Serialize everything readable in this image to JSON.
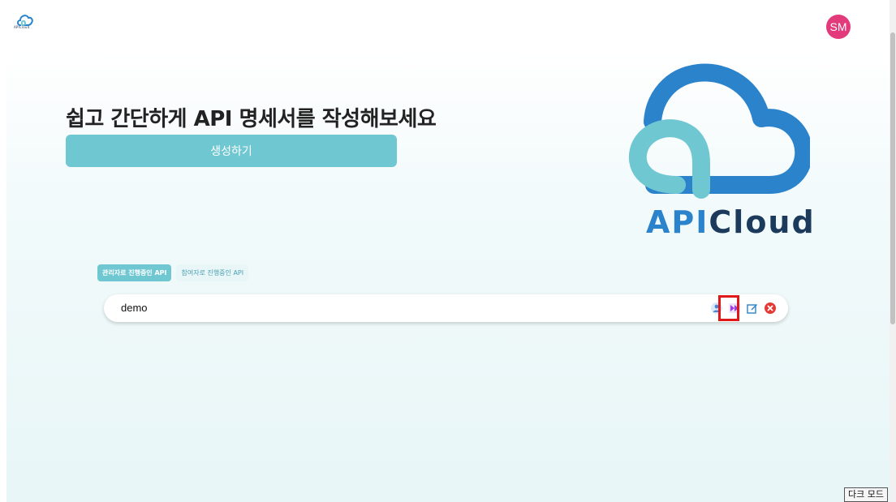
{
  "header": {
    "logo_text": "APICloud",
    "avatar_initials": "SM",
    "avatar_color": "#e23a7a"
  },
  "hero": {
    "headline": "쉽고 간단하게 API 명세서를 작성해보세요",
    "create_button_label": "생성하기",
    "logo_api": "API",
    "logo_cloud": "Cloud"
  },
  "tabs": [
    {
      "label": "관리자로 진행중인 API",
      "active": true
    },
    {
      "label": "참여자로 진행중인 API",
      "active": false
    }
  ],
  "api_list": [
    {
      "name": "demo",
      "actions": [
        "user-icon",
        "run-icon",
        "edit-icon",
        "delete-icon"
      ]
    }
  ],
  "footer": {
    "dark_mode_label": "다크 모드"
  },
  "colors": {
    "accent": "#6fc7d1",
    "logo_blue": "#2b83cc",
    "logo_navy": "#1b3a5c",
    "highlight": "#e01818"
  }
}
